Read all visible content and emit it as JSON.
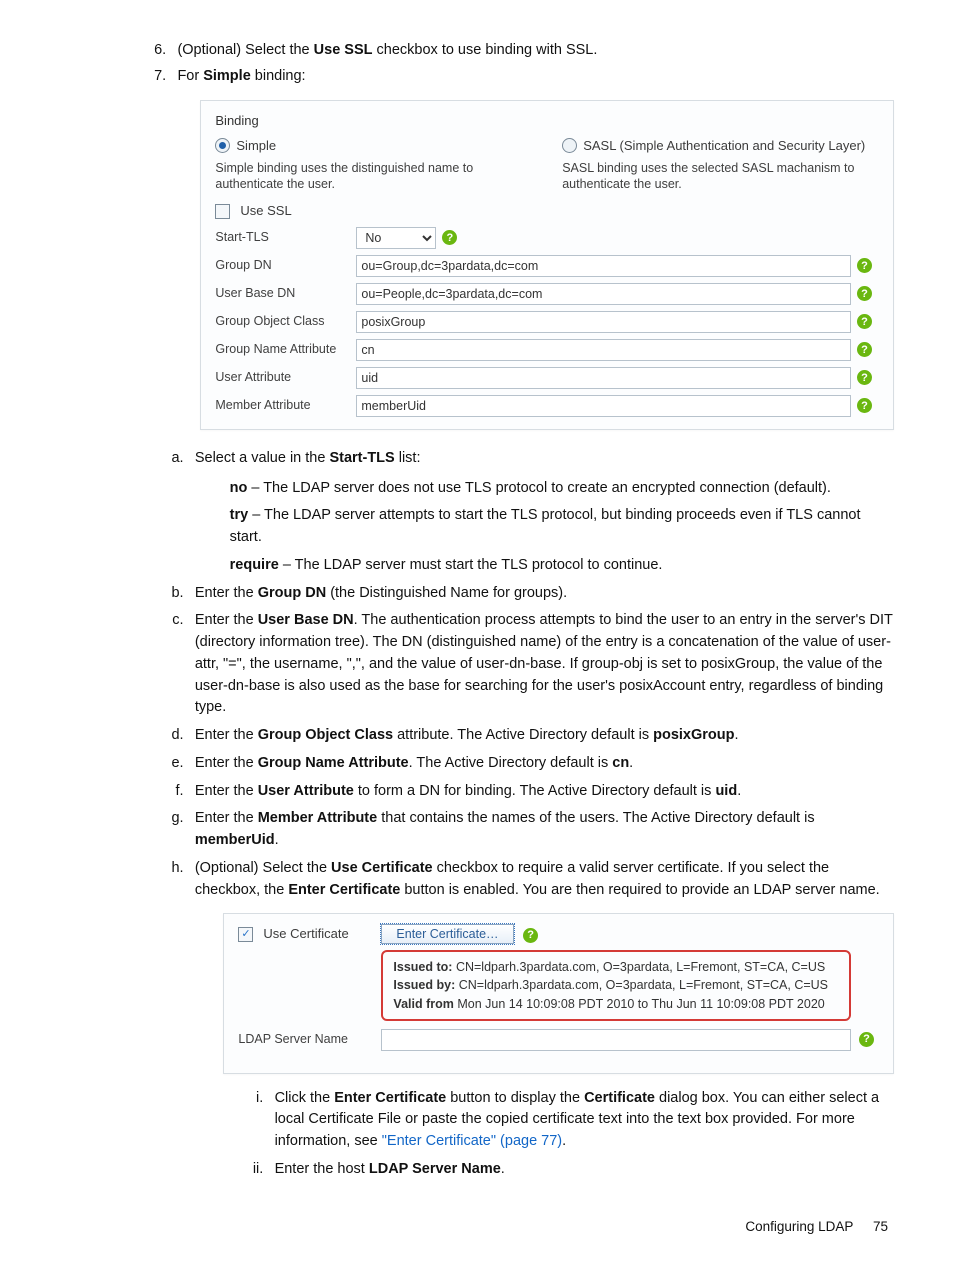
{
  "main_list": {
    "start": 6,
    "items": [
      {
        "prefix": "(Optional) Select the ",
        "bold": "Use SSL",
        "suffix": " checkbox to use binding with SSL."
      },
      {
        "prefix": "For ",
        "bold": "Simple",
        "suffix": " binding:"
      }
    ]
  },
  "panel1": {
    "title": "Binding",
    "simple_label": "Simple",
    "simple_desc": "Simple binding uses the distinguished name to authenticate the user.",
    "sasl_label": "SASL (Simple Authentication and Security Layer)",
    "sasl_desc": "SASL binding uses the selected SASL machanism to authenticate the user.",
    "use_ssl_label": "Use SSL",
    "rows": {
      "start_tls": {
        "label": "Start-TLS",
        "value": "No"
      },
      "group_dn": {
        "label": "Group DN",
        "value": "ou=Group,dc=3pardata,dc=com"
      },
      "user_base_dn": {
        "label": "User Base DN",
        "value": "ou=People,dc=3pardata,dc=com"
      },
      "group_obj": {
        "label": "Group Object Class",
        "value": "posixGroup"
      },
      "group_name_attr": {
        "label": "Group Name Attribute",
        "value": "cn"
      },
      "user_attr": {
        "label": "User Attribute",
        "value": "uid"
      },
      "member_attr": {
        "label": "Member Attribute",
        "value": "memberUid"
      }
    }
  },
  "alpha_list": {
    "a_intro": {
      "pre": "Select a value in the ",
      "b": "Start-TLS",
      "post": " list:"
    },
    "a_sub": {
      "no": {
        "b": "no",
        "t": " – The LDAP server does not use TLS protocol to create an encrypted connection (default)."
      },
      "try": {
        "b": "try",
        "t": " – The LDAP server attempts to start the TLS protocol, but binding proceeds even if TLS cannot start."
      },
      "require": {
        "b": "require",
        "t": " – The LDAP server must start the TLS protocol to continue."
      }
    },
    "b": {
      "pre": "Enter the ",
      "b": "Group DN",
      "post": " (the Distinguished Name for groups)."
    },
    "c": {
      "pre": "Enter the ",
      "b": "User Base DN",
      "post": ". The authentication process attempts to bind the user to an entry in the server's DIT (directory information tree). The DN (distinguished name) of the entry is a concatenation of the value of user-attr, \"=\", the username, \",\", and the value of user-dn-base. If group-obj is set to posixGroup, the value of the user-dn-base is also used as the base for searching for the user's posixAccount entry, regardless of binding type."
    },
    "d": {
      "pre": "Enter the ",
      "b": "Group Object Class",
      "mid": " attribute. The Active Directory default is ",
      "b2": "posixGroup",
      "post": "."
    },
    "e": {
      "pre": "Enter the ",
      "b": "Group Name Attribute",
      "mid": ". The Active Directory default is ",
      "b2": "cn",
      "post": "."
    },
    "f": {
      "pre": "Enter the ",
      "b": "User Attribute",
      "mid": " to form a DN for binding. The Active Directory default is ",
      "b2": "uid",
      "post": "."
    },
    "g": {
      "pre": "Enter the ",
      "b": "Member Attribute",
      "mid": " that contains the names of the users. The Active Directory default is ",
      "b2": "memberUid",
      "post": "."
    },
    "h": {
      "pre": "(Optional) Select the ",
      "b": "Use Certificate",
      "mid": " checkbox to require a valid server certificate. If you select the checkbox, the ",
      "b2": "Enter Certificate",
      "post": " button is enabled. You are then required to provide an LDAP server name."
    }
  },
  "panel2": {
    "use_cert_label": "Use Certificate",
    "enter_cert_button": "Enter Certificate…",
    "cert_info": {
      "to_label": "Issued to:",
      "to_value": " CN=ldparh.3pardata.com, O=3pardata, L=Fremont, ST=CA, C=US",
      "by_label": "Issued by:",
      "by_value": " CN=ldparh.3pardata.com, O=3pardata, L=Fremont, ST=CA, C=US",
      "valid_label": "Valid from",
      "valid_value": " Mon Jun 14 10:09:08 PDT 2010 to Thu Jun 11 10:09:08 PDT 2020"
    },
    "ldap_server_label": "LDAP Server Name",
    "ldap_server_value": ""
  },
  "roman_list": {
    "i": {
      "t1": "Click the ",
      "b1": "Enter Certificate",
      "t2": " button to display the ",
      "b2": "Certificate",
      "t3": " dialog box. You can either select a local Certificate File or paste the copied certificate text into the text box provided. For more information, see ",
      "link": "\"Enter Certificate\" (page 77)",
      "t4": "."
    },
    "ii": {
      "t1": "Enter the host ",
      "b1": "LDAP Server Name",
      "t2": "."
    }
  },
  "footer": {
    "title": "Configuring LDAP",
    "page": "75"
  },
  "help_char": "?"
}
